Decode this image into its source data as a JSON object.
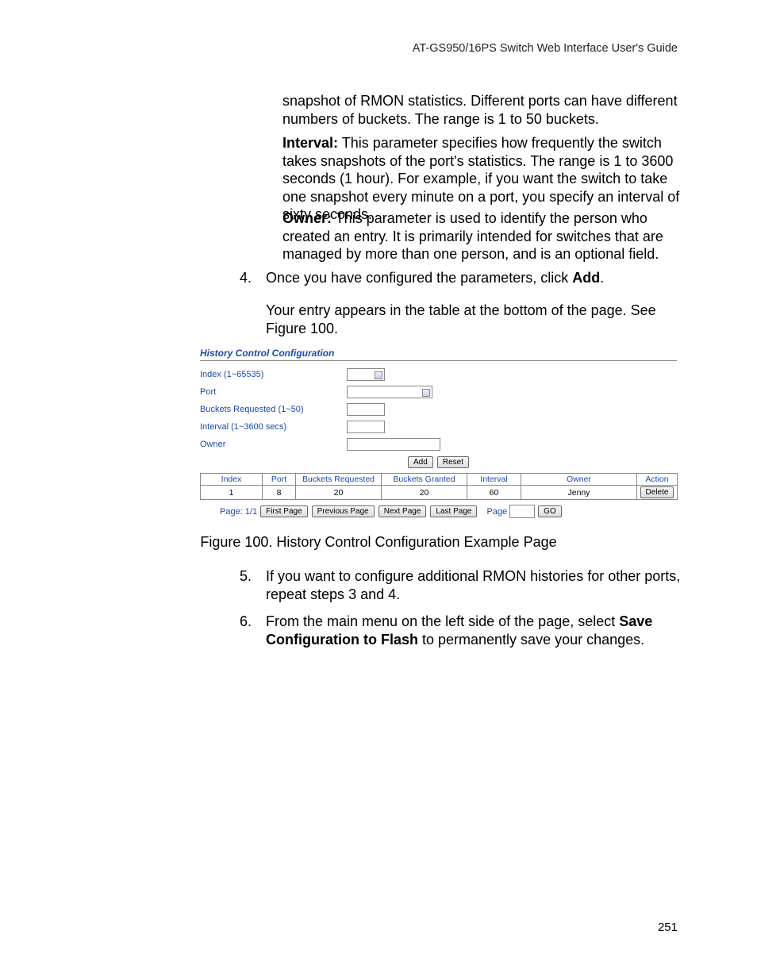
{
  "header": "AT-GS950/16PS Switch Web Interface User's Guide",
  "page_number": "251",
  "paras": {
    "snapshot": "snapshot of RMON statistics. Different ports can have different numbers of buckets. The range is 1 to 50 buckets.",
    "interval_bold": "Interval:",
    "interval_rest": " This parameter specifies how frequently the switch takes snapshots of the port's statistics. The range is 1 to 3600 seconds (1 hour). For example, if you want the switch to take one snapshot every minute on a port, you specify an interval of sixty seconds.",
    "owner_bold": "Owner:",
    "owner_rest": " This parameter is used to identify the person who created an entry. It is primarily intended for switches that are managed by more than one person, and is an optional field.",
    "step4_num": "4.",
    "step4_a": "Once you have configured the parameters, click ",
    "step4_bold": "Add",
    "step4_b": ".",
    "step4_followup": "Your entry appears in the table at the bottom of the page. See Figure 100.",
    "fig_caption": "Figure 100. History Control Configuration Example Page",
    "step5_num": "5.",
    "step5": "If you want to configure additional RMON histories for other ports, repeat steps 3 and 4.",
    "step6_num": "6.",
    "step6_a": "From the main menu on the left side of the page, select ",
    "step6_bold": "Save Configuration to Flash",
    "step6_b": " to permanently save your changes."
  },
  "figure": {
    "title": "History Control Configuration",
    "labels": {
      "index": "Index (1~65535)",
      "port": "Port",
      "buckets": "Buckets Requested (1~50)",
      "interval": "Interval (1~3600 secs)",
      "owner": "Owner"
    },
    "buttons": {
      "add": "Add",
      "reset": "Reset",
      "first": "First Page",
      "prev": "Previous Page",
      "next": "Next Page",
      "last": "Last Page",
      "go": "GO",
      "delete": "Delete"
    },
    "table": {
      "headers": [
        "Index",
        "Port",
        "Buckets Requested",
        "Buckets Granted",
        "Interval",
        "Owner",
        "Action"
      ],
      "row": [
        "1",
        "8",
        "20",
        "20",
        "60",
        "Jenny"
      ]
    },
    "pager": {
      "label_left": "Page: 1/1",
      "label_page": "Page"
    }
  }
}
